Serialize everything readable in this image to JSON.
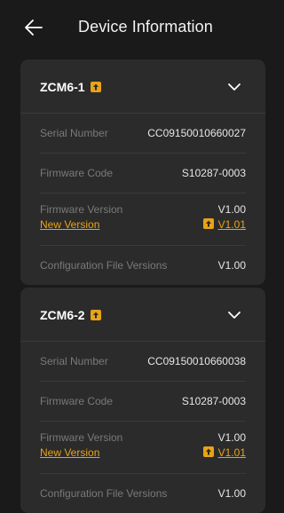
{
  "header": {
    "title": "Device Information"
  },
  "colors": {
    "accent": "#e8a317",
    "background": "#1a1a1a",
    "card": "#2b2b2b"
  },
  "devices": [
    {
      "name": "ZCM6-1",
      "serial_label": "Serial Number",
      "serial": "CC09150010660027",
      "fw_code_label": "Firmware Code",
      "fw_code": "S10287-0003",
      "fw_version_label": "Firmware Version",
      "fw_version": "V1.00",
      "new_version_label": "New Version",
      "new_version": "V1.01",
      "config_label": "Configuration File Versions",
      "config_version": "V1.00"
    },
    {
      "name": "ZCM6-2",
      "serial_label": "Serial Number",
      "serial": "CC09150010660038",
      "fw_code_label": "Firmware Code",
      "fw_code": "S10287-0003",
      "fw_version_label": "Firmware Version",
      "fw_version": "V1.00",
      "new_version_label": "New Version",
      "new_version": "V1.01",
      "config_label": "Configuration File Versions",
      "config_version": "V1.00"
    }
  ]
}
